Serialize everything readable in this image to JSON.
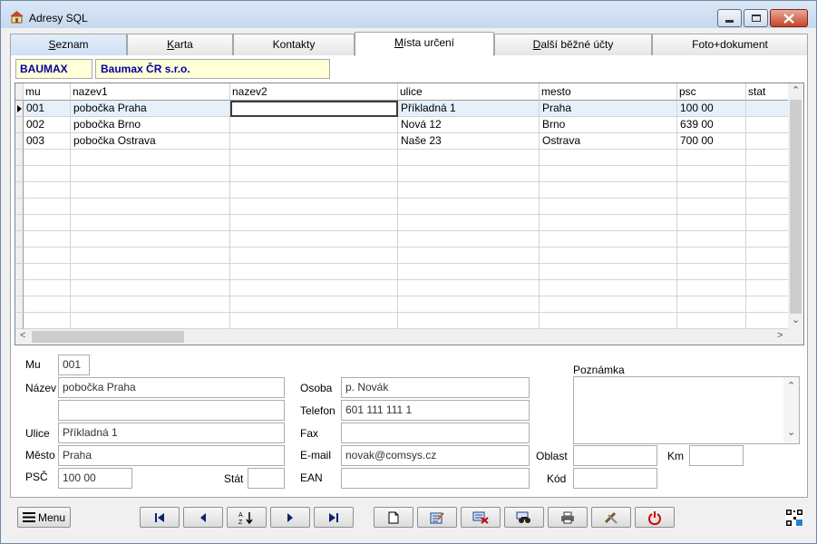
{
  "window": {
    "title": "Adresy SQL",
    "accent": "#0000a0"
  },
  "tabs": [
    {
      "label": "Seznam",
      "underline": "S",
      "rest": "eznam"
    },
    {
      "label": "Karta",
      "underline": "K",
      "rest": "arta"
    },
    {
      "label": "Kontakty",
      "underline": "",
      "rest": "Kontakty"
    },
    {
      "label": "Místa určení",
      "underline": "M",
      "rest": "ísta určení"
    },
    {
      "label": "Další běžné účty",
      "underline": "D",
      "rest": "alší běžné účty"
    },
    {
      "label": "Foto+dokument",
      "underline": "",
      "rest": "Foto+dokument"
    }
  ],
  "header": {
    "code": "BAUMAX",
    "name": "Baumax ČR s.r.o."
  },
  "grid": {
    "columns": [
      "mu",
      "nazev1",
      "nazev2",
      "ulice",
      "mesto",
      "psc",
      "stat"
    ],
    "rows": [
      [
        "001",
        "pobočka Praha",
        "",
        "Příkladná  1",
        "Praha",
        "100 00",
        ""
      ],
      [
        "002",
        "pobočka Brno",
        "",
        "Nová 12",
        "Brno",
        "639 00",
        ""
      ],
      [
        "003",
        "pobočka Ostrava",
        "",
        "Naše 23",
        "Ostrava",
        "700 00",
        ""
      ]
    ]
  },
  "form": {
    "mu_label": "Mu",
    "mu_value": "001",
    "nazev_label": "Název",
    "nazev_value": "pobočka Praha",
    "nazev2_value": "",
    "ulice_label": "Ulice",
    "ulice_value": "Příkladná  1",
    "mesto_label": "Město",
    "mesto_value": "Praha",
    "psc_label": "PSČ",
    "psc_value": "100 00",
    "stat_label": "Stát",
    "stat_value": "",
    "osoba_label": "Osoba",
    "osoba_value": "p. Novák",
    "telefon_label": "Telefon",
    "telefon_value": "601 111 111 1",
    "fax_label": "Fax",
    "fax_value": "",
    "email_label": "E-mail",
    "email_value": "novak@comsys.cz",
    "ean_label": "EAN",
    "ean_value": "",
    "poznamka_label": "Poznámka",
    "oblast_label": "Oblast",
    "oblast_value": "",
    "km_label": "Km",
    "km_value": "",
    "kod_label": "Kód",
    "kod_value": ""
  },
  "toolbar": {
    "menu_label": "Menu"
  }
}
